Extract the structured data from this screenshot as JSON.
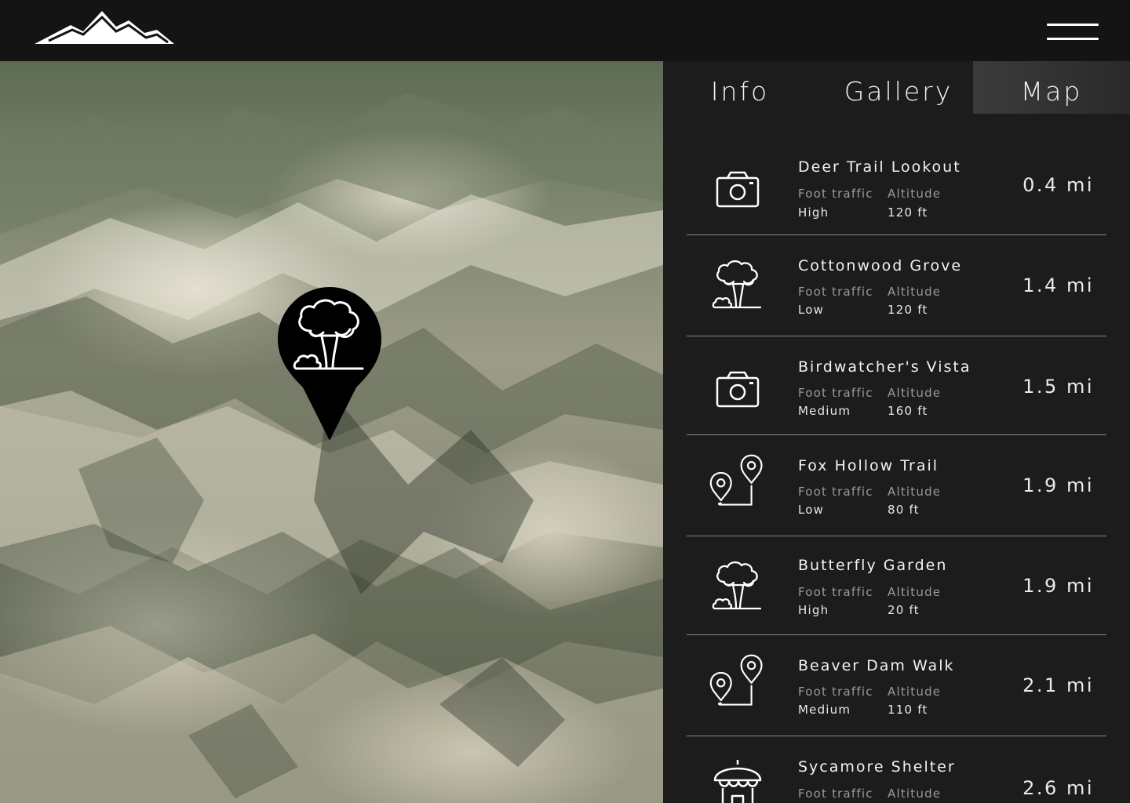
{
  "header": {
    "logo_icon": "mountain-logo-icon",
    "menu_icon": "hamburger-menu-icon"
  },
  "map": {
    "selected_pin_icon": "tree-icon"
  },
  "tabs": [
    {
      "label": "Info",
      "active": false
    },
    {
      "label": "Gallery",
      "active": false
    },
    {
      "label": "Map",
      "active": true
    }
  ],
  "poi_labels": {
    "foot_traffic": "Foot traffic",
    "altitude": "Altitude"
  },
  "poi_list": [
    {
      "name": "Deer Trail Lookout",
      "icon": "camera-icon",
      "foot_traffic": "High",
      "altitude": "120 ft",
      "distance": "0.4 mi"
    },
    {
      "name": "Cottonwood Grove",
      "icon": "tree-icon",
      "foot_traffic": "Low",
      "altitude": "120 ft",
      "distance": "1.4 mi"
    },
    {
      "name": "Birdwatcher's Vista",
      "icon": "camera-icon",
      "foot_traffic": "Medium",
      "altitude": "160 ft",
      "distance": "1.5 mi"
    },
    {
      "name": "Fox Hollow Trail",
      "icon": "route-pins-icon",
      "foot_traffic": "Low",
      "altitude": "80 ft",
      "distance": "1.9 mi"
    },
    {
      "name": "Butterfly Garden",
      "icon": "tree-icon",
      "foot_traffic": "High",
      "altitude": "20 ft",
      "distance": "1.9 mi"
    },
    {
      "name": "Beaver Dam Walk",
      "icon": "route-pins-icon",
      "foot_traffic": "Medium",
      "altitude": "110 ft",
      "distance": "2.1 mi"
    },
    {
      "name": "Sycamore Shelter",
      "icon": "shelter-icon",
      "foot_traffic": "",
      "altitude": "",
      "distance": "2.6 mi"
    }
  ]
}
